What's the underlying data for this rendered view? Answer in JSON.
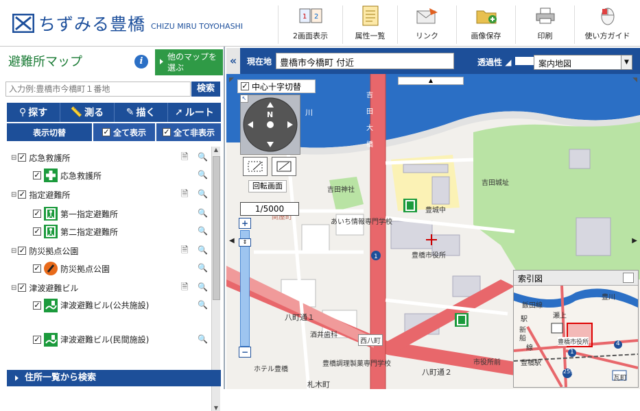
{
  "header": {
    "logo_text": "ちずみる豊橋",
    "logo_sub": "CHIZU MIRU TOYOHASHI",
    "toolbar": [
      {
        "label": "2画面表示",
        "icon": "split-screen-icon"
      },
      {
        "label": "属性一覧",
        "icon": "document-list-icon"
      },
      {
        "label": "リンク",
        "icon": "envelope-link-icon"
      },
      {
        "label": "画像保存",
        "icon": "folder-save-icon"
      },
      {
        "label": "印刷",
        "icon": "printer-icon"
      },
      {
        "label": "使い方ガイド",
        "icon": "mouse-guide-icon"
      }
    ]
  },
  "sidebar": {
    "title": "避難所マップ",
    "info_icon": "i",
    "other_maps": "他のマップを選ぶ",
    "search_placeholder": "入力例:豊橋市今橋町１番地",
    "search_button": "検索",
    "tools": [
      "探す",
      "測る",
      "描く",
      "ルート"
    ],
    "display_toggle": "表示切替",
    "show_all": "全て表示",
    "hide_all": "全て非表示",
    "layers": [
      {
        "group": "応急救護所",
        "checked": true,
        "items": [
          "応急救護所"
        ]
      },
      {
        "group": "指定避難所",
        "checked": true,
        "items": [
          "第一指定避難所",
          "第二指定避難所"
        ]
      },
      {
        "group": "防災拠点公園",
        "checked": true,
        "items": [
          "防災拠点公園"
        ]
      },
      {
        "group": "津波避難ビル",
        "checked": true,
        "items": [
          "津波避難ビル(公共施設)",
          "津波避難ビル(民間施設)"
        ]
      }
    ],
    "address_search": "住所一覧から検索"
  },
  "mapbar": {
    "collapse": "«",
    "location_label": "現在地",
    "location_value": "豊橋市今橋町 付近",
    "transparency_label": "透過性",
    "basemap": "案内地図"
  },
  "map": {
    "crosshair_toggle": "中心十字切替",
    "rotate_label": "回転画面",
    "scale": "1/5000",
    "compass_n": "N",
    "index_title": "索引図",
    "labels": [
      {
        "text": "吉田神社"
      },
      {
        "text": "吉田城址"
      },
      {
        "text": "あいち情報専門学校"
      },
      {
        "text": "豊城中"
      },
      {
        "text": "豊橋市役所"
      },
      {
        "text": "八町通１"
      },
      {
        "text": "酒井歯科"
      },
      {
        "text": "西八町"
      },
      {
        "text": "豊橋調理製菓専門学校"
      },
      {
        "text": "ホテル豊橋"
      },
      {
        "text": "八町通２"
      },
      {
        "text": "市役所前"
      },
      {
        "text": "札木町"
      },
      {
        "text": "吉田大橋"
      },
      {
        "text": "関屋町"
      },
      {
        "text": "川"
      }
    ],
    "index_labels": [
      "豊川",
      "瀬上",
      "新",
      "線",
      "豊橋市役所",
      "豊橋駅",
      "瓦町",
      "飯田線",
      "船",
      "駅",
      "4",
      "1",
      "259"
    ],
    "colors": {
      "water": "#2b6fc5",
      "park": "#b9e3a4",
      "road": "#e8676b",
      "building": "#d7d7e0",
      "accent": "#1d4f99",
      "green": "#2f9a46"
    }
  }
}
